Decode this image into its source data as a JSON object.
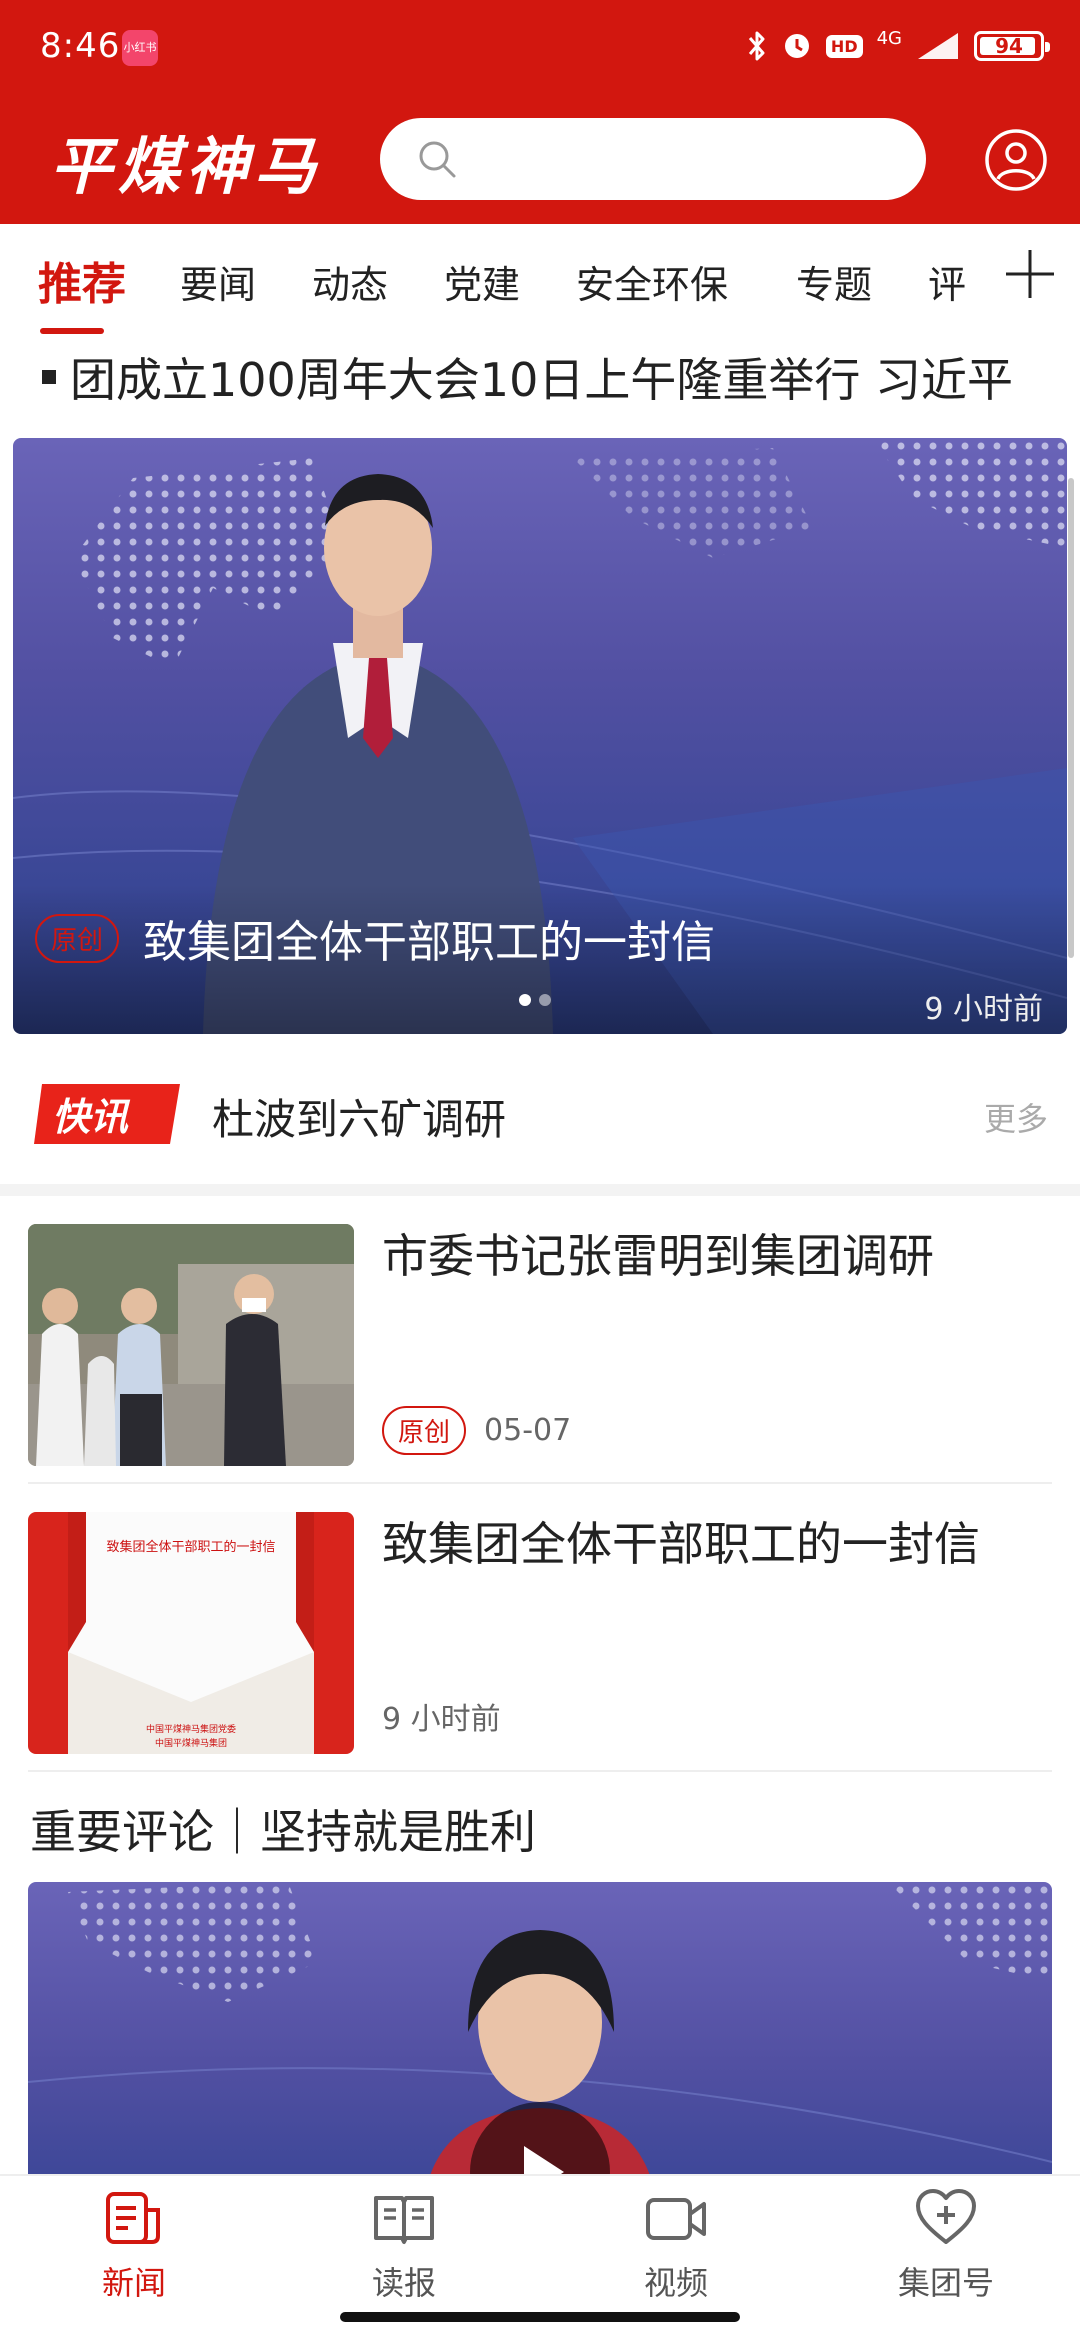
{
  "status_bar": {
    "time": "8:46",
    "app_badge": "小红书",
    "network": "4G",
    "hd": "HD",
    "battery": "94",
    "battery_level_percent": 94
  },
  "header": {
    "logo_text": "平煤神马",
    "search_placeholder": "",
    "accent_color": "#d2170f"
  },
  "tabs": [
    {
      "label": "推荐",
      "active": true
    },
    {
      "label": "要闻"
    },
    {
      "label": "动态"
    },
    {
      "label": "党建"
    },
    {
      "label": "安全环保"
    },
    {
      "label": "专题"
    },
    {
      "label": "评"
    }
  ],
  "ticker": {
    "text": "团成立100周年大会10日上午隆重举行 习近平"
  },
  "banner": {
    "tag": "原创",
    "title": "致集团全体干部职工的一封信",
    "time": "9 小时前",
    "slide_count": 2,
    "active_slide": 1
  },
  "flash": {
    "badge": "快讯",
    "text": "杜波到六矿调研",
    "more": "更多"
  },
  "news": [
    {
      "title": "市委书记张雷明到集团调研",
      "tag": "原创",
      "date": "05-07"
    },
    {
      "title": "致集团全体干部职工的一封信",
      "time": "9 小时前",
      "thumb_heading": "致集团全体干部职工的一封信",
      "thumb_footer_1": "中国平煤神马集团党委",
      "thumb_footer_2": "中国平煤神马集团"
    }
  ],
  "section": {
    "title": "重要评论｜坚持就是胜利"
  },
  "bottom_nav": [
    {
      "label": "新闻",
      "icon": "news-icon",
      "active": true
    },
    {
      "label": "读报",
      "icon": "book-icon"
    },
    {
      "label": "视频",
      "icon": "video-camera-icon"
    },
    {
      "label": "集团号",
      "icon": "heart-plus-icon"
    }
  ]
}
